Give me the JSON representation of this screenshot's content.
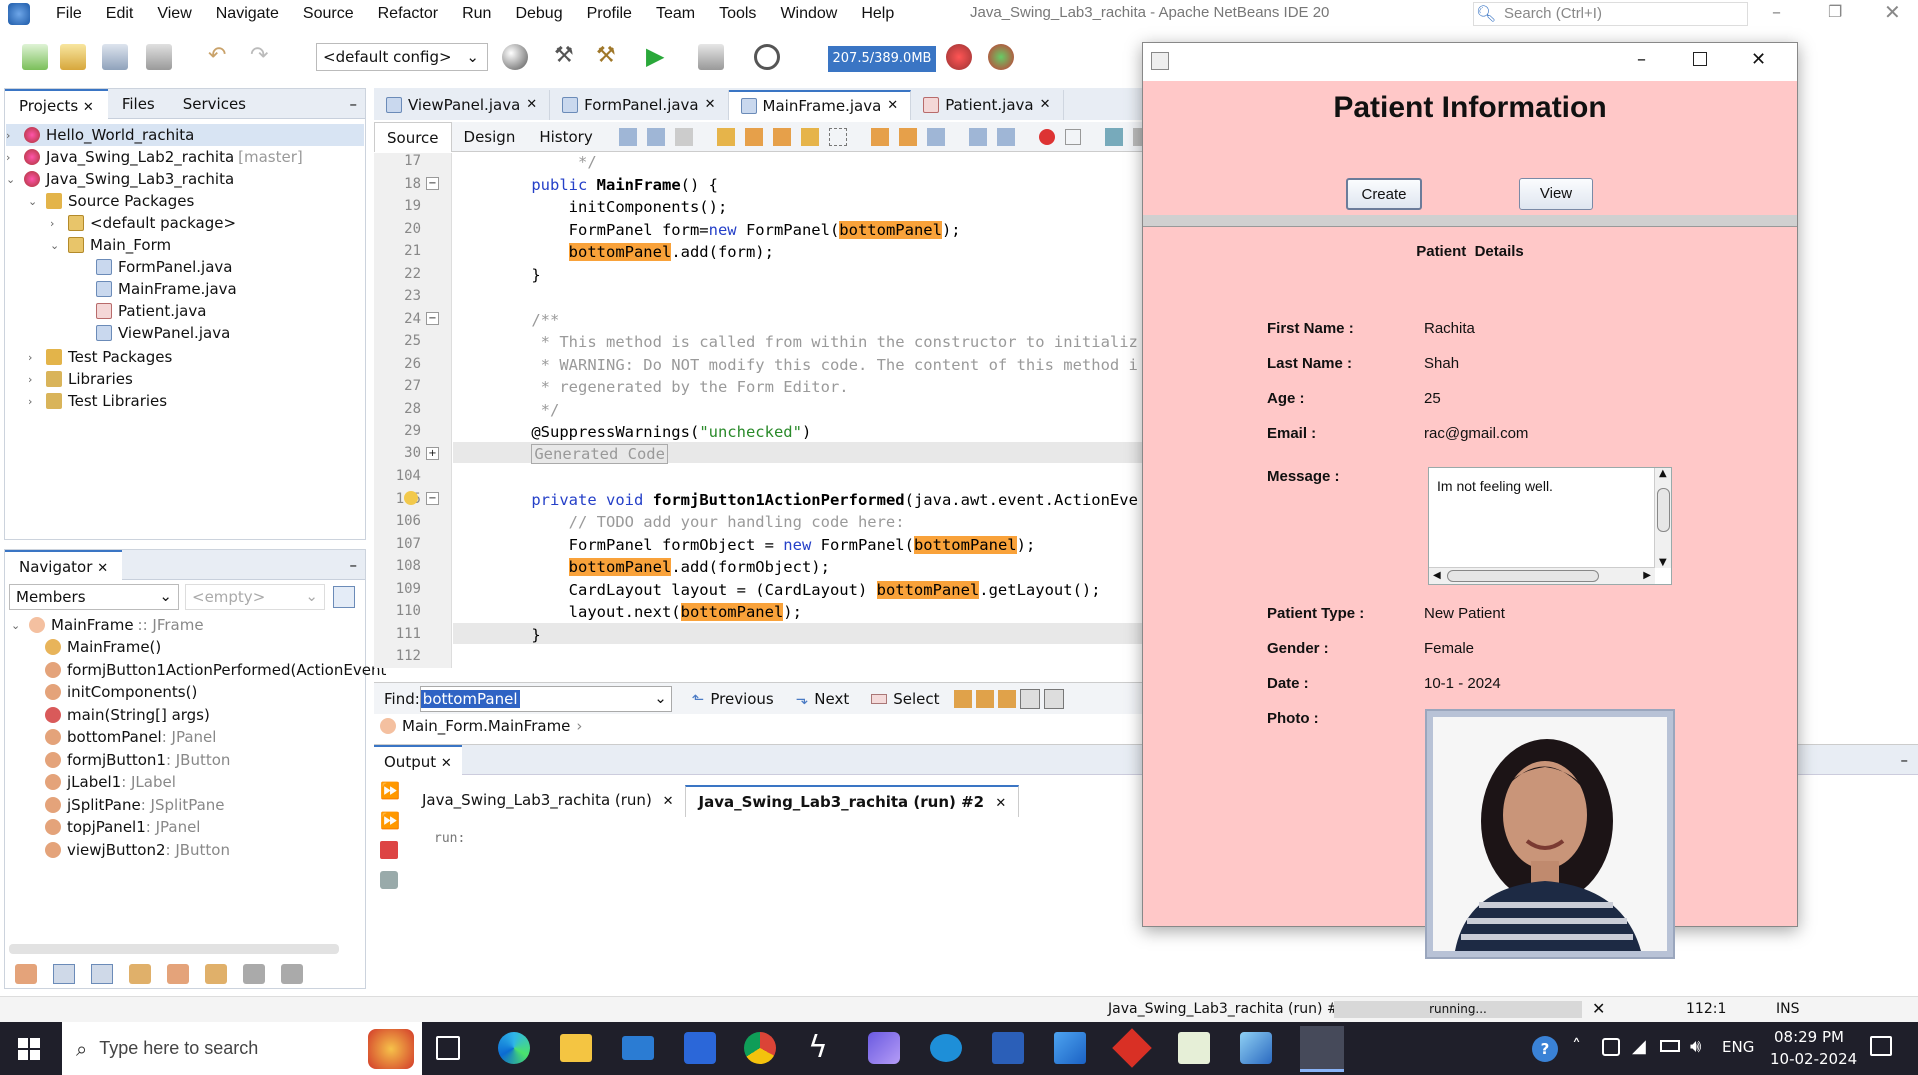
{
  "menubar": {
    "items": [
      "File",
      "Edit",
      "View",
      "Navigate",
      "Source",
      "Refactor",
      "Run",
      "Debug",
      "Profile",
      "Team",
      "Tools",
      "Window",
      "Help"
    ],
    "window_title": "Java_Swing_Lab3_rachita - Apache NetBeans IDE 20",
    "search_placeholder": "Search (Ctrl+I)"
  },
  "toolbar": {
    "config": "<default config>",
    "memory": "207.5/389.0MB"
  },
  "projects_panel": {
    "tabs": [
      "Projects",
      "Files",
      "Services"
    ],
    "tree": [
      "Hello_World_rachita",
      "Java_Swing_Lab2_rachita",
      "Java_Swing_Lab3_rachita",
      "Source Packages",
      "<default package>",
      "Main_Form",
      "FormPanel.java",
      "MainFrame.java",
      "Patient.java",
      "ViewPanel.java",
      "Test Packages",
      "Libraries",
      "Test Libraries"
    ],
    "lab2_branch": "[master]"
  },
  "navigator": {
    "title": "Navigator",
    "filter": "Members",
    "empty": "<empty>",
    "root_name": "MainFrame",
    "root_type": ":: JFrame",
    "members": [
      {
        "name": "MainFrame()",
        "type": ""
      },
      {
        "name": "formjButton1ActionPerformed(ActionEvent",
        "type": ""
      },
      {
        "name": "initComponents()",
        "type": ""
      },
      {
        "name": "main(String[] args)",
        "type": ""
      },
      {
        "name": "bottomPanel",
        "type": " : JPanel"
      },
      {
        "name": "formjButton1",
        "type": " : JButton"
      },
      {
        "name": "jLabel1",
        "type": " : JLabel"
      },
      {
        "name": "jSplitPane",
        "type": " : JSplitPane"
      },
      {
        "name": "topjPanel1",
        "type": " : JPanel"
      },
      {
        "name": "viewjButton2",
        "type": " : JButton"
      }
    ]
  },
  "editor": {
    "tabs": [
      "ViewPanel.java",
      "FormPanel.java",
      "MainFrame.java",
      "Patient.java"
    ],
    "subtabs": [
      "Source",
      "Design",
      "History"
    ],
    "line_numbers": [
      "17",
      "18",
      "19",
      "20",
      "21",
      "22",
      "23",
      "24",
      "25",
      "26",
      "27",
      "28",
      "29",
      "30",
      "104",
      "105",
      "106",
      "107",
      "108",
      "109",
      "110",
      "111",
      "112"
    ],
    "find_label": "Find:",
    "find_value": "bottomPanel",
    "previous": "Previous",
    "next": "Next",
    "select": "Select",
    "breadcrumb": "Main_Form.MainFrame"
  },
  "output": {
    "title": "Output",
    "tabs": [
      "Java_Swing_Lab3_rachita (run)",
      "Java_Swing_Lab3_rachita (run) #2"
    ],
    "text": "run:"
  },
  "statusbar": {
    "task": "Java_Swing_Lab3_rachita (run) #2",
    "progress": "running...",
    "position": "112:1",
    "mode": "INS"
  },
  "taskbar": {
    "search_placeholder": "Type here to search",
    "lang": "ENG",
    "time": "08:29 PM",
    "date": "10-02-2024"
  },
  "patient_window": {
    "title": "Patient Information",
    "create_btn": "Create",
    "view_btn": "View",
    "details_title": "Patient  Details",
    "fields": {
      "first_name_label": "First Name :",
      "first_name": "Rachita",
      "last_name_label": "Last Name :",
      "last_name": "Shah",
      "age_label": "Age :",
      "age": "25",
      "email_label": "Email :",
      "email": "rac@gmail.com",
      "message_label": "Message :",
      "message": "Im not feeling well.",
      "patient_type_label": "Patient Type :",
      "patient_type": "New Patient",
      "gender_label": "Gender :",
      "gender": "Female",
      "date_label": "Date :",
      "date": "10-1 - 2024",
      "photo_label": "Photo :"
    },
    "bg_color": "#ffc8c8"
  }
}
